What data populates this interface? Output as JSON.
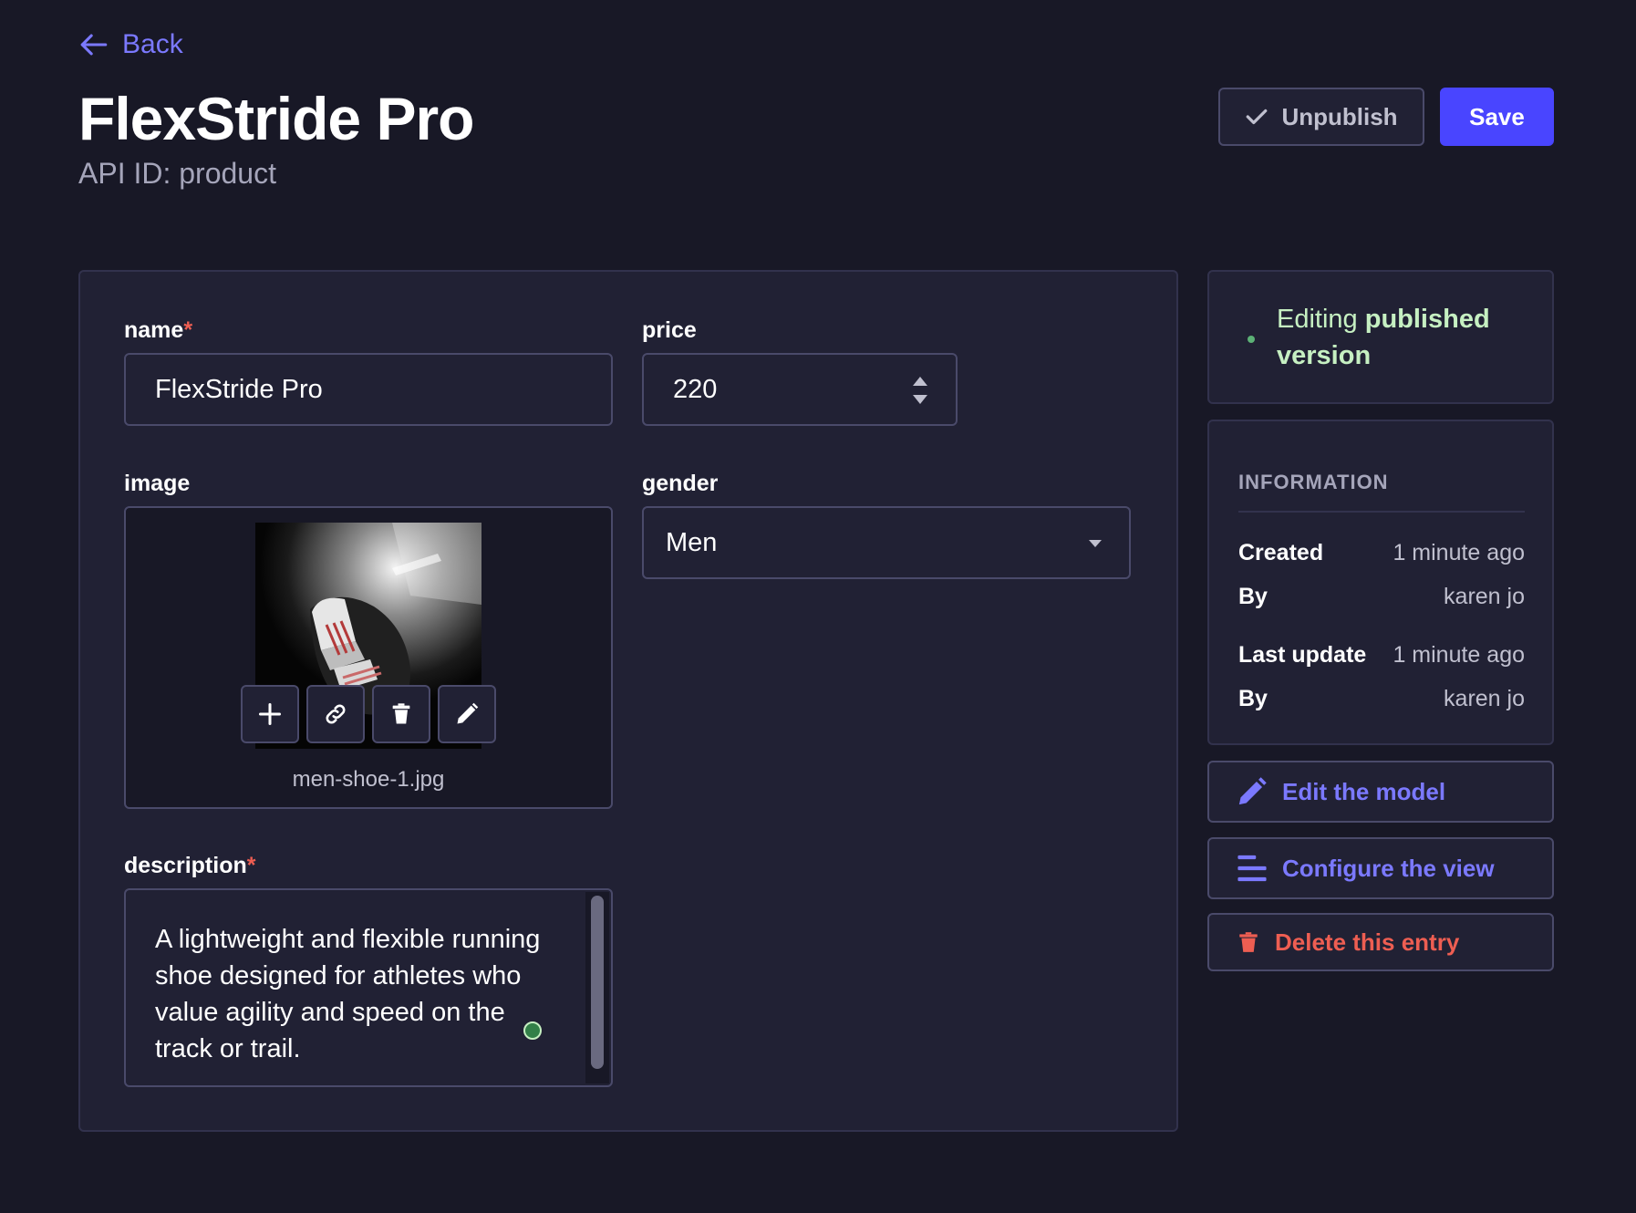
{
  "header": {
    "back_label": "Back",
    "title": "FlexStride Pro",
    "subtitle": "API ID: product",
    "unpublish_label": "Unpublish",
    "save_label": "Save"
  },
  "form": {
    "name": {
      "label": "name",
      "required_mark": "*",
      "value": "FlexStride Pro"
    },
    "price": {
      "label": "price",
      "value": "220"
    },
    "image": {
      "label": "image",
      "filename": "men-shoe-1.jpg",
      "actions": [
        "plus-icon",
        "link-icon",
        "trash-icon",
        "pencil-icon"
      ]
    },
    "gender": {
      "label": "gender",
      "value": "Men"
    },
    "description": {
      "label": "description",
      "required_mark": "*",
      "value": "A lightweight and flexible running shoe designed for athletes who value agility and speed on the track or trail."
    }
  },
  "status": {
    "prefix": "Editing",
    "state": "published version"
  },
  "information": {
    "heading": "INFORMATION",
    "rows": [
      {
        "key": "Created",
        "value": "1 minute ago"
      },
      {
        "key": "By",
        "value": "karen jo"
      },
      {
        "key": "Last update",
        "value": "1 minute ago"
      },
      {
        "key": "By",
        "value": "karen jo"
      }
    ]
  },
  "actions": {
    "edit_model": "Edit the model",
    "configure_view": "Configure the view",
    "delete_entry": "Delete this entry"
  },
  "colors": {
    "background": "#181826",
    "card": "#212134",
    "primary": "#4945ff",
    "primary_text": "#7b79ff",
    "danger": "#ee5e52",
    "success_text": "#c6f0c2"
  }
}
